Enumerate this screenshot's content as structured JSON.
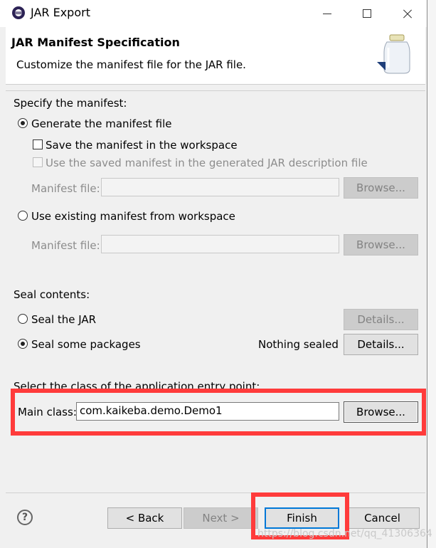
{
  "window": {
    "title": "JAR Export"
  },
  "banner": {
    "title": "JAR Manifest Specification",
    "description": "Customize the manifest file for the JAR file."
  },
  "manifest": {
    "section_label": "Specify the manifest:",
    "generate_option": "Generate the manifest file",
    "generate_selected": true,
    "save_checkbox": "Save the manifest in the workspace",
    "use_saved_checkbox": "Use the saved manifest in the generated JAR description file",
    "manifest_file_label": "Manifest file:",
    "browse_label": "Browse...",
    "existing_option": "Use existing manifest from workspace",
    "existing_manifest_label": "Manifest file:",
    "existing_browse_label": "Browse..."
  },
  "seal": {
    "section_label": "Seal contents:",
    "seal_jar_option": "Seal the JAR",
    "seal_jar_details": "Details...",
    "seal_packages_option": "Seal some packages",
    "seal_packages_selected": true,
    "status": "Nothing sealed",
    "seal_packages_details": "Details..."
  },
  "entry_point": {
    "section_label": "Select the class of the application entry point:",
    "main_class_label": "Main class:",
    "main_class_value": "com.kaikeba.demo.Demo1",
    "browse_label": "Browse..."
  },
  "footer": {
    "back_label": "< Back",
    "next_label": "Next >",
    "finish_label": "Finish",
    "cancel_label": "Cancel"
  },
  "watermark": "https://blog.csdn.net/qq_41306364",
  "colors": {
    "highlight": "#ff3b3b",
    "focus": "#0078d7"
  }
}
